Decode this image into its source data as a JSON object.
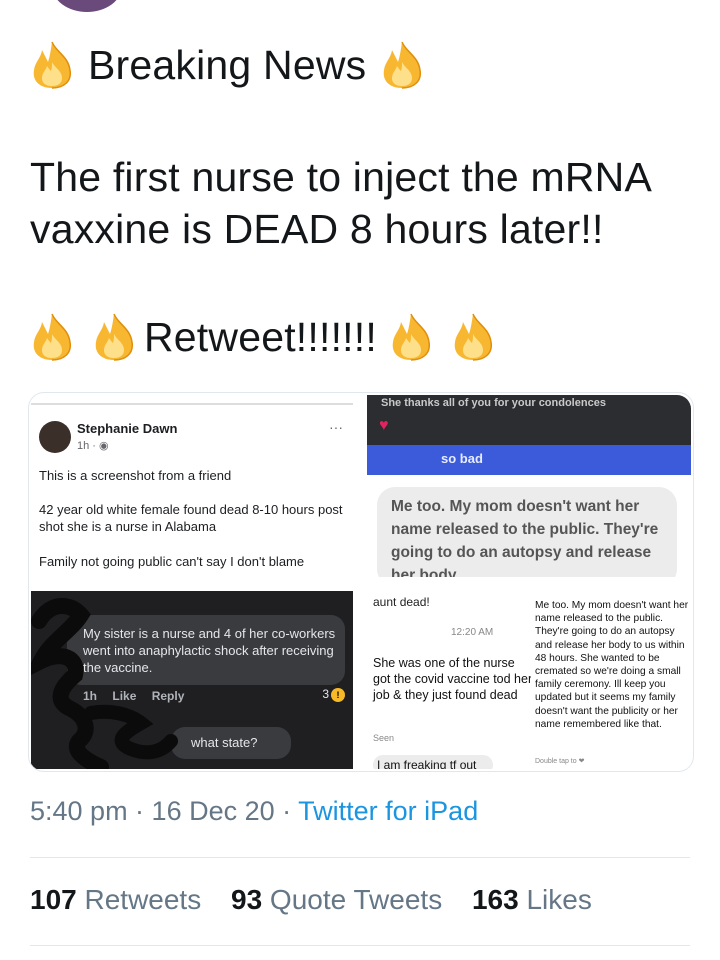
{
  "tweet": {
    "line_breaking": "Breaking News",
    "body_line1": "The first nurse to inject the mRNA",
    "body_line2": "vaxxine is DEAD 8 hours later!!",
    "line_retweet": "Retweet!!!!!!!",
    "emoji": "fire-emoji"
  },
  "media": {
    "fb_post": {
      "author": "Stephanie Dawn",
      "time": "1h · ",
      "more": "···",
      "p1": "This is a screenshot from a friend",
      "p2": "42 year old white female found dead 8-10 hours post shot she is a nurse in Alabama",
      "p3": "Family not going public can't say I don't blame"
    },
    "msg_top_right": {
      "header": "She thanks all of you for your condolences",
      "blue_text": "so bad",
      "gray_text": "Me too. My mom doesn't want her name released to the public. They're going to do an autopsy and release her body"
    },
    "dark_comment": {
      "text": "My sister is a nurse and 4 of her co-workers went into anaphylactic shock after receiving the vaccine.",
      "time": "1h",
      "like": "Like",
      "reply": "Reply",
      "count": "3",
      "reply_text": "what state?"
    },
    "text_msgs": {
      "top": "aunt dead!",
      "time": "12:20 AM",
      "msg": "She was one of the nurse got the covid vaccine tod her job & they just found dead",
      "seen": "Seen",
      "last": "I am freaking tf out",
      "right_msg": "Me too. My mom doesn't want her name released to the public. They're going to do an autopsy and release her body to us within 48 hours. She wanted to be cremated so we're doing a small family ceremony. Ill keep you updated but it seems my family doesn't want the publicity or her name remembered like that.",
      "right_foot": "Double tap to ❤"
    }
  },
  "meta": {
    "time": "5:40 pm · 16 Dec 20 · ",
    "source": "Twitter for iPad"
  },
  "stats": {
    "retweets_num": "107",
    "retweets_label": " Retweets",
    "quotes_num": "93",
    "quotes_label": " Quote Tweets",
    "likes_num": "163",
    "likes_label": " Likes"
  },
  "colors": {
    "text": "#14171a",
    "secondary": "#657786",
    "link": "#1b95e0",
    "fire": "#f5a623"
  }
}
